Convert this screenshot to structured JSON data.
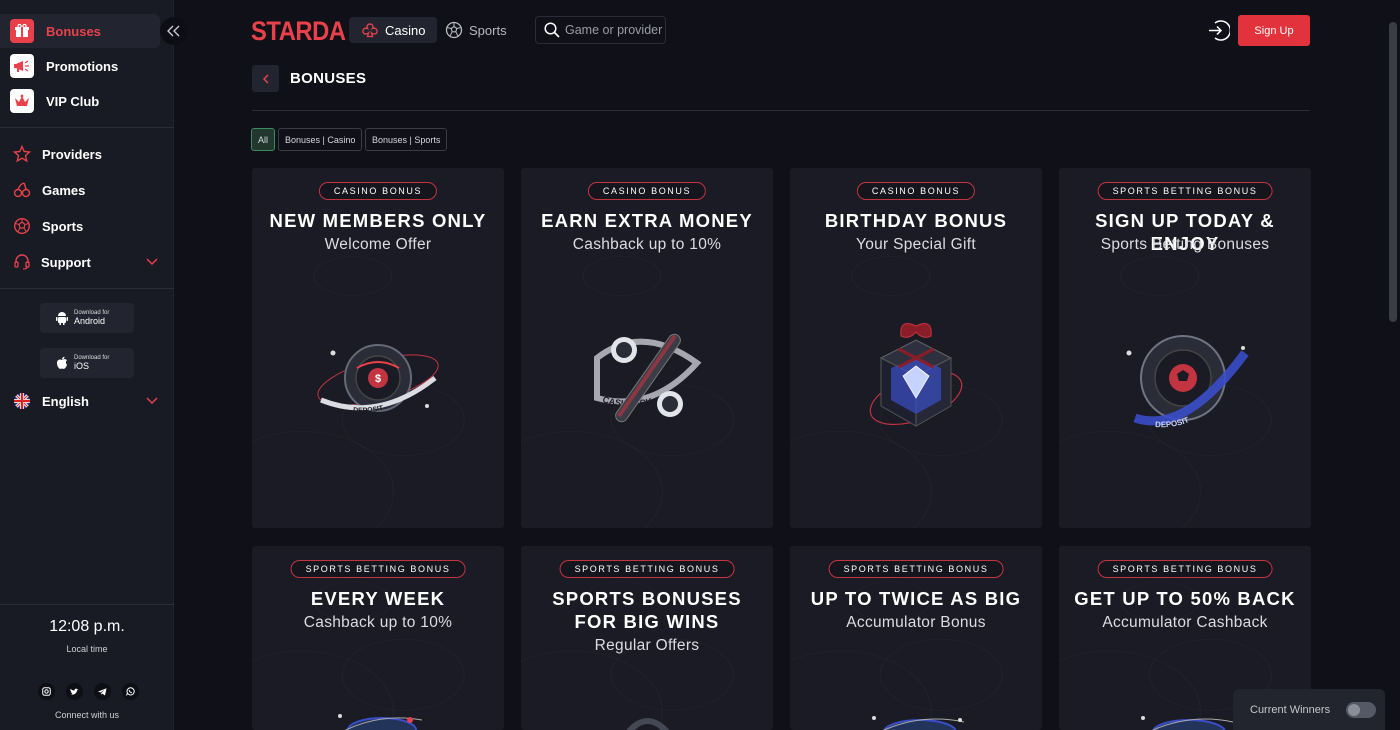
{
  "sidebar": {
    "items": [
      {
        "label": "Bonuses",
        "icon": "gift-icon"
      },
      {
        "label": "Promotions",
        "icon": "megaphone-icon"
      },
      {
        "label": "VIP Club",
        "icon": "crown-icon"
      },
      {
        "label": "Providers",
        "icon": "star-icon"
      },
      {
        "label": "Games",
        "icon": "cherries-icon"
      },
      {
        "label": "Sports",
        "icon": "ball-icon"
      },
      {
        "label": "Support",
        "icon": "headset-icon"
      }
    ],
    "downloads": [
      {
        "small": "Download for",
        "big": "Android"
      },
      {
        "small": "Download for",
        "big": "iOS"
      }
    ],
    "language": "English",
    "time": "12:08 p.m.",
    "time_label": "Local time",
    "connect_label": "Connect with us"
  },
  "header": {
    "logo": "STARDA",
    "tabs": [
      "Casino",
      "Sports"
    ],
    "search_placeholder": "Game or provider",
    "signup_label": "Sign Up"
  },
  "page": {
    "title": "BONUSES",
    "filters": [
      "All",
      "Bonuses | Casino",
      "Bonuses | Sports"
    ]
  },
  "cards": [
    {
      "badge": "CASINO BONUS",
      "title": "NEW MEMBERS ONLY",
      "subtitle": "Welcome Offer"
    },
    {
      "badge": "CASINO BONUS",
      "title": "EARN EXTRA MONEY",
      "subtitle": "Cashback up to 10%"
    },
    {
      "badge": "CASINO BONUS",
      "title": "BIRTHDAY BONUS",
      "subtitle": "Your Special Gift"
    },
    {
      "badge": "SPORTS BETTING BONUS",
      "title": "SIGN UP TODAY & ENJOY",
      "subtitle": "Sports Betting Bonuses"
    },
    {
      "badge": "SPORTS BETTING BONUS",
      "title": "EVERY WEEK",
      "subtitle": "Cashback up to 10%"
    },
    {
      "badge": "SPORTS BETTING BONUS",
      "title": "SPORTS BONUSES FOR BIG WINS",
      "subtitle": "Regular Offers"
    },
    {
      "badge": "SPORTS BETTING BONUS",
      "title": "UP TO TWICE AS BIG",
      "subtitle": "Accumulator Bonus"
    },
    {
      "badge": "SPORTS BETTING BONUS",
      "title": "GET UP TO 50% BACK",
      "subtitle": "Accumulator Cashback"
    }
  ],
  "art_text": {
    "deposit": "DEPOSIT",
    "cashback": "CASHBACK"
  },
  "winners": {
    "label": "Current Winners"
  },
  "colors": {
    "accent": "#e8414b",
    "background": "#0f1018",
    "card": "#1a1b24",
    "filter_active": "#3b8a5e"
  }
}
